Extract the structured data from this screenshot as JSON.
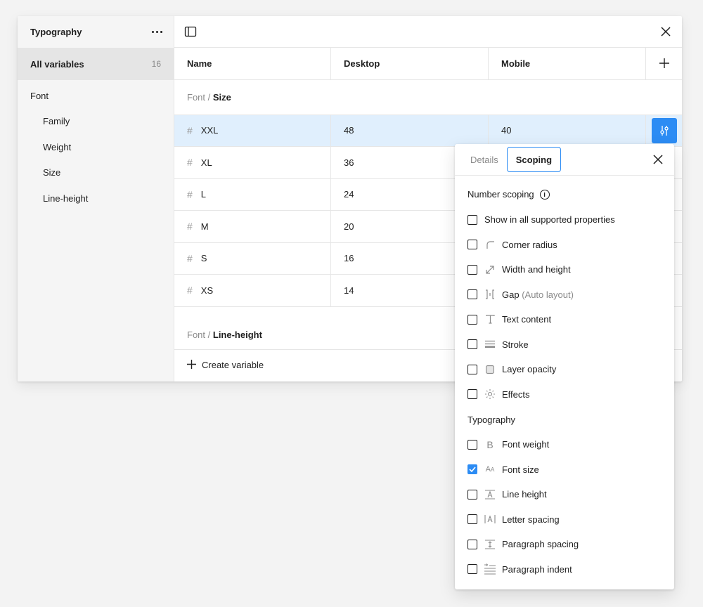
{
  "sidebar": {
    "title": "Typography",
    "all_label": "All variables",
    "all_count": "16",
    "groups": [
      {
        "label": "Font"
      },
      {
        "label": "Family"
      },
      {
        "label": "Weight"
      },
      {
        "label": "Size"
      },
      {
        "label": "Line-height"
      }
    ]
  },
  "table": {
    "headers": [
      "Name",
      "Desktop",
      "Mobile"
    ],
    "group1": {
      "prefix": "Font /",
      "name": "Size"
    },
    "rows": [
      {
        "name": "XXL",
        "desktop": "48",
        "mobile": "40"
      },
      {
        "name": "XL",
        "desktop": "36",
        "mobile": ""
      },
      {
        "name": "L",
        "desktop": "24",
        "mobile": ""
      },
      {
        "name": "M",
        "desktop": "20",
        "mobile": ""
      },
      {
        "name": "S",
        "desktop": "16",
        "mobile": ""
      },
      {
        "name": "XS",
        "desktop": "14",
        "mobile": ""
      }
    ],
    "group2": {
      "prefix": "Font /",
      "name": "Line-height"
    },
    "create_label": "Create variable"
  },
  "popover": {
    "tabs": [
      "Details",
      "Scoping"
    ],
    "active_tab": "Scoping",
    "number_title": "Number scoping",
    "number_options": [
      {
        "label": "Show in all supported properties",
        "icon": "none",
        "checked": false
      },
      {
        "label": "Corner radius",
        "icon": "corner-radius-icon",
        "checked": false
      },
      {
        "label": "Width and height",
        "icon": "resize-icon",
        "checked": false
      },
      {
        "label": "Gap",
        "suffix": "(Auto layout)",
        "icon": "gap-icon",
        "checked": false
      },
      {
        "label": "Text content",
        "icon": "text-icon",
        "checked": false
      },
      {
        "label": "Stroke",
        "icon": "stroke-icon",
        "checked": false
      },
      {
        "label": "Layer opacity",
        "icon": "opacity-icon",
        "checked": false
      },
      {
        "label": "Effects",
        "icon": "effects-icon",
        "checked": false
      }
    ],
    "typography_title": "Typography",
    "typography_options": [
      {
        "label": "Font weight",
        "icon": "font-weight-icon",
        "checked": false
      },
      {
        "label": "Font size",
        "icon": "font-size-icon",
        "checked": true
      },
      {
        "label": "Line height",
        "icon": "line-height-icon",
        "checked": false
      },
      {
        "label": "Letter spacing",
        "icon": "letter-spacing-icon",
        "checked": false
      },
      {
        "label": "Paragraph spacing",
        "icon": "paragraph-spacing-icon",
        "checked": false
      },
      {
        "label": "Paragraph indent",
        "icon": "paragraph-indent-icon",
        "checked": false
      }
    ]
  },
  "colors": {
    "accent": "#2c8cf4",
    "selected_row": "#e0effd"
  }
}
